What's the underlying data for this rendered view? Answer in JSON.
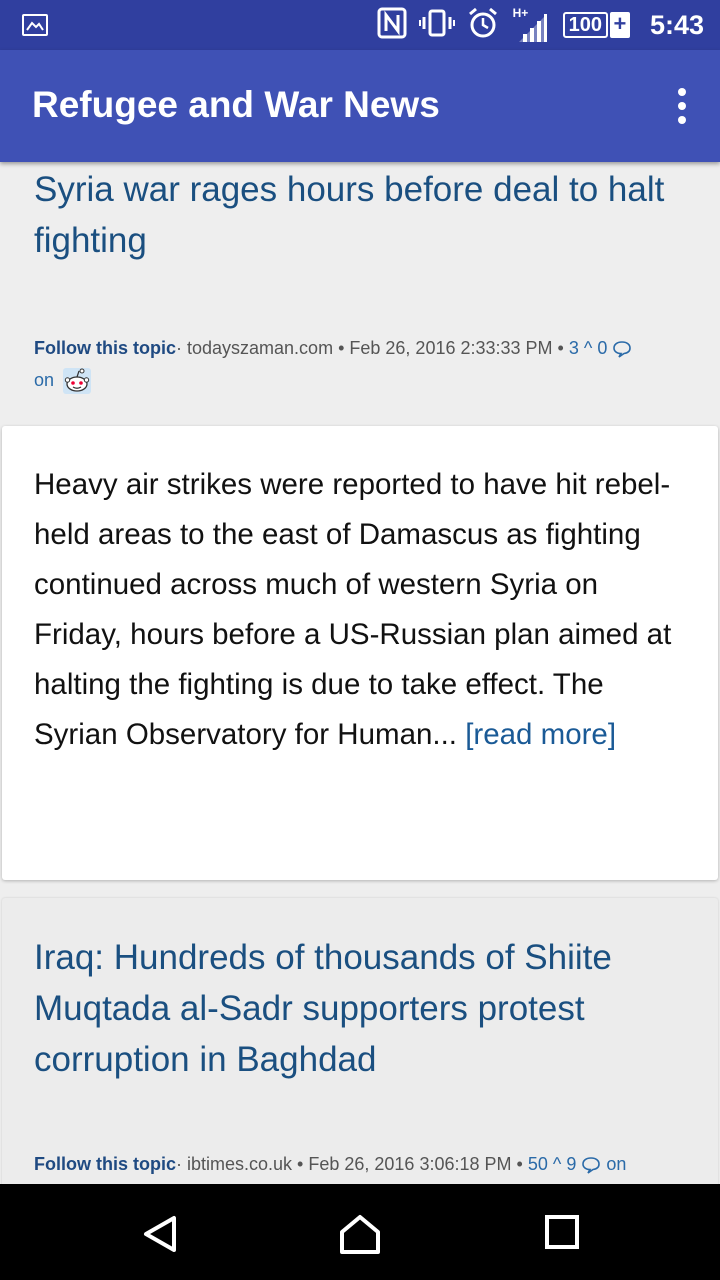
{
  "status_bar": {
    "icons": [
      "image-icon",
      "nfc-icon",
      "vibrate-icon",
      "alarm-icon",
      "signal-icon"
    ],
    "network": "H+",
    "battery": "100",
    "battery_plus": "+",
    "time": "5:43"
  },
  "app_bar": {
    "title": "Refugee and War News",
    "menu_icon": "more-vert-icon"
  },
  "articles": [
    {
      "title": "Syria war rages hours before deal to halt fighting",
      "follow": "Follow this topic",
      "source": "todayszaman.com",
      "date": "Feb 26, 2016 2:33:33 PM",
      "upvotes": "3",
      "comments": "0",
      "on_label": "on",
      "summary": "Heavy air strikes were reported to have hit rebel-held areas to the east of Damascus as fighting continued across much of western Syria on Friday, hours before a US-Russian plan aimed at halting the fighting is due to take effect. The Syrian Observatory for Human...",
      "read_more": "[read more]"
    },
    {
      "title": "Iraq: Hundreds of thousands of Shiite Muqtada al-Sadr supporters protest corruption in Baghdad",
      "follow": "Follow this topic",
      "source": "ibtimes.co.uk",
      "date": "Feb 26, 2016 3:06:18 PM",
      "upvotes": "50",
      "comments": "9",
      "on_label": "on"
    }
  ],
  "nav_bar": {
    "icons": [
      "back-icon",
      "home-icon",
      "recents-icon"
    ]
  },
  "colors": {
    "status_bar": "#303f9f",
    "app_bar": "#3f51b5",
    "link": "#1a4f80"
  }
}
